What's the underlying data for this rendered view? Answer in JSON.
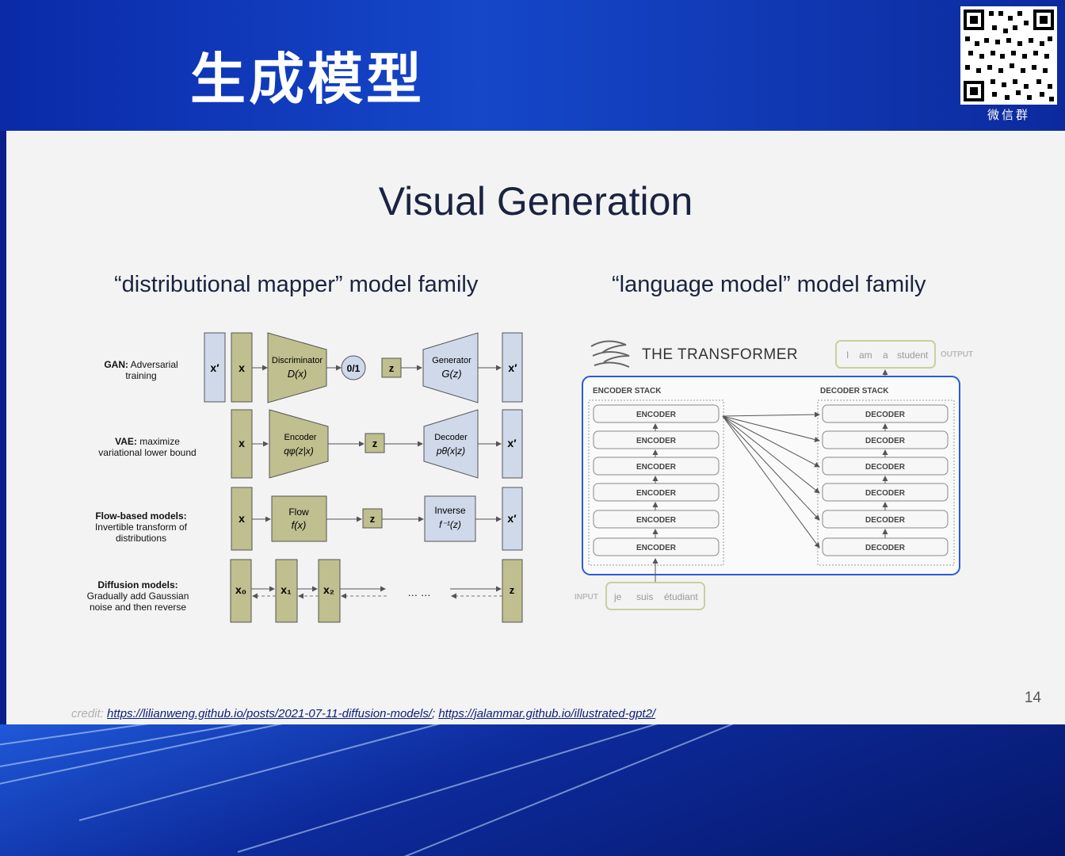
{
  "header": {
    "title_cn": "生成模型",
    "qr_caption": "微信群"
  },
  "slide": {
    "title": "Visual Generation",
    "left_heading": "“distributional mapper” model family",
    "right_heading": "“language model” model family",
    "page_number": "14",
    "credit_label": "credit:",
    "credit_link_1": "https://lilianweng.github.io/posts/2021-07-11-diffusion-models/",
    "credit_separator": ";",
    "credit_link_2": "https://jalammar.github.io/illustrated-gpt2/"
  },
  "left_diagram": {
    "gan": {
      "name": "GAN:",
      "desc1": " Adversarial",
      "desc2": "training",
      "x_prime": "x′",
      "x": "x",
      "disc_label": "Discriminator",
      "disc_formula": "D(x)",
      "out": "0/1",
      "z": "z",
      "gen_label": "Generator",
      "gen_formula": "G(z)",
      "x_prime2": "x′"
    },
    "vae": {
      "name": "VAE:",
      "desc1": " maximize",
      "desc2": "variational lower bound",
      "x": "x",
      "enc_label": "Encoder",
      "enc_formula": "qφ(z|x)",
      "z": "z",
      "dec_label": "Decoder",
      "dec_formula": "pθ(x|z)",
      "x_prime": "x′"
    },
    "flow": {
      "name": "Flow-based models:",
      "desc1": "Invertible transform of",
      "desc2": "distributions",
      "x": "x",
      "flow_label": "Flow",
      "flow_formula": "f(x)",
      "z": "z",
      "inv_label": "Inverse",
      "inv_formula": "f⁻¹(z)",
      "x_prime": "x′"
    },
    "diffusion": {
      "name": "Diffusion models:",
      "desc1": "Gradually add Gaussian",
      "desc2": "noise and then reverse",
      "x0": "x₀",
      "x1": "x₁",
      "x2": "x₂",
      "dots": "… …",
      "z": "z"
    }
  },
  "right_diagram": {
    "title": "THE TRANSFORMER",
    "encoder_stack_label": "ENCODER STACK",
    "decoder_stack_label": "DECODER STACK",
    "encoders": [
      "ENCODER",
      "ENCODER",
      "ENCODER",
      "ENCODER",
      "ENCODER",
      "ENCODER"
    ],
    "decoders": [
      "DECODER",
      "DECODER",
      "DECODER",
      "DECODER",
      "DECODER",
      "DECODER"
    ],
    "input_label": "INPUT",
    "input_tokens": [
      "je",
      "suis",
      "étudiant"
    ],
    "output_label": "OUTPUT",
    "output_tokens": [
      "I",
      "am",
      "a",
      "student"
    ]
  }
}
